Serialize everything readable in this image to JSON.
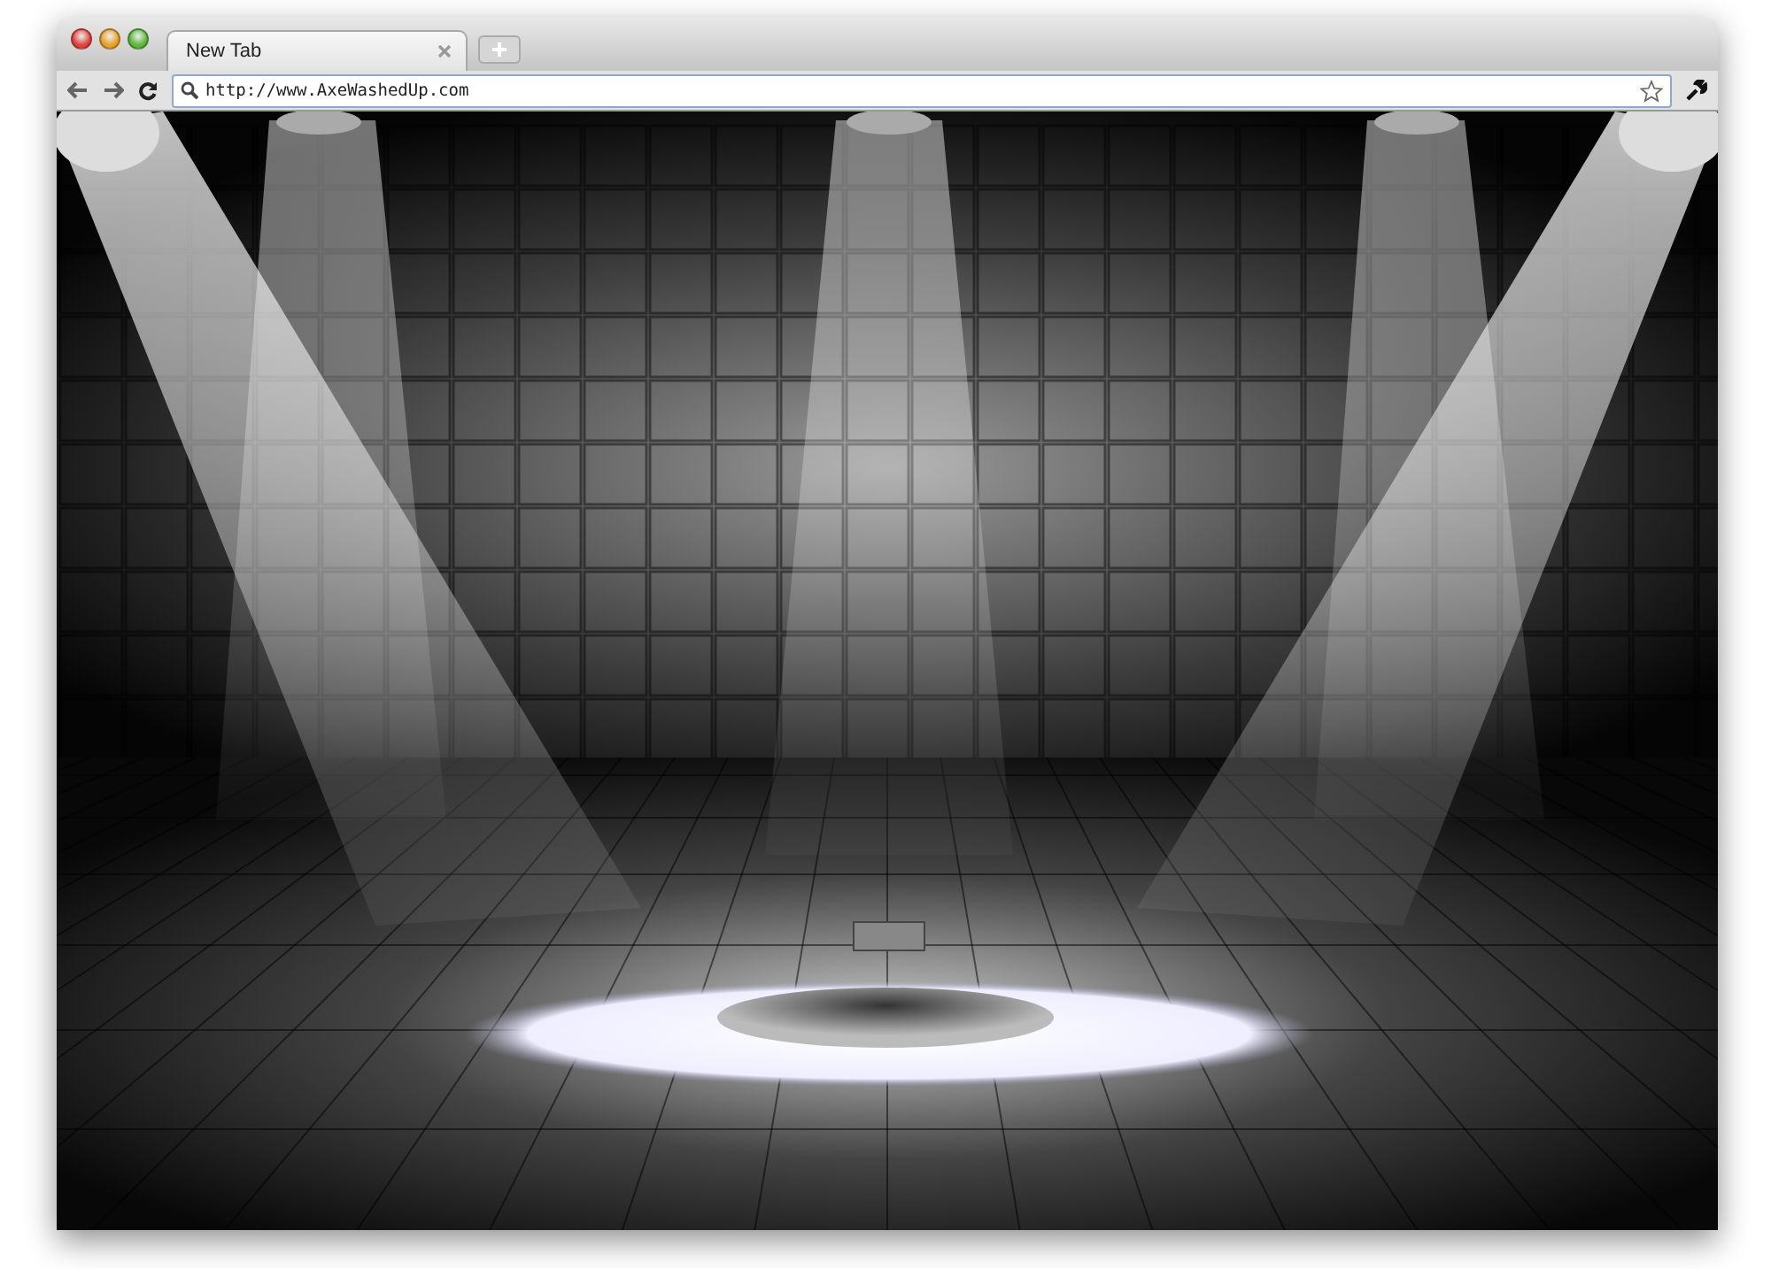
{
  "tabs": [
    {
      "title": "New Tab",
      "selected": true
    }
  ],
  "address_bar": {
    "url": "http://www.AxeWashedUp.com"
  }
}
